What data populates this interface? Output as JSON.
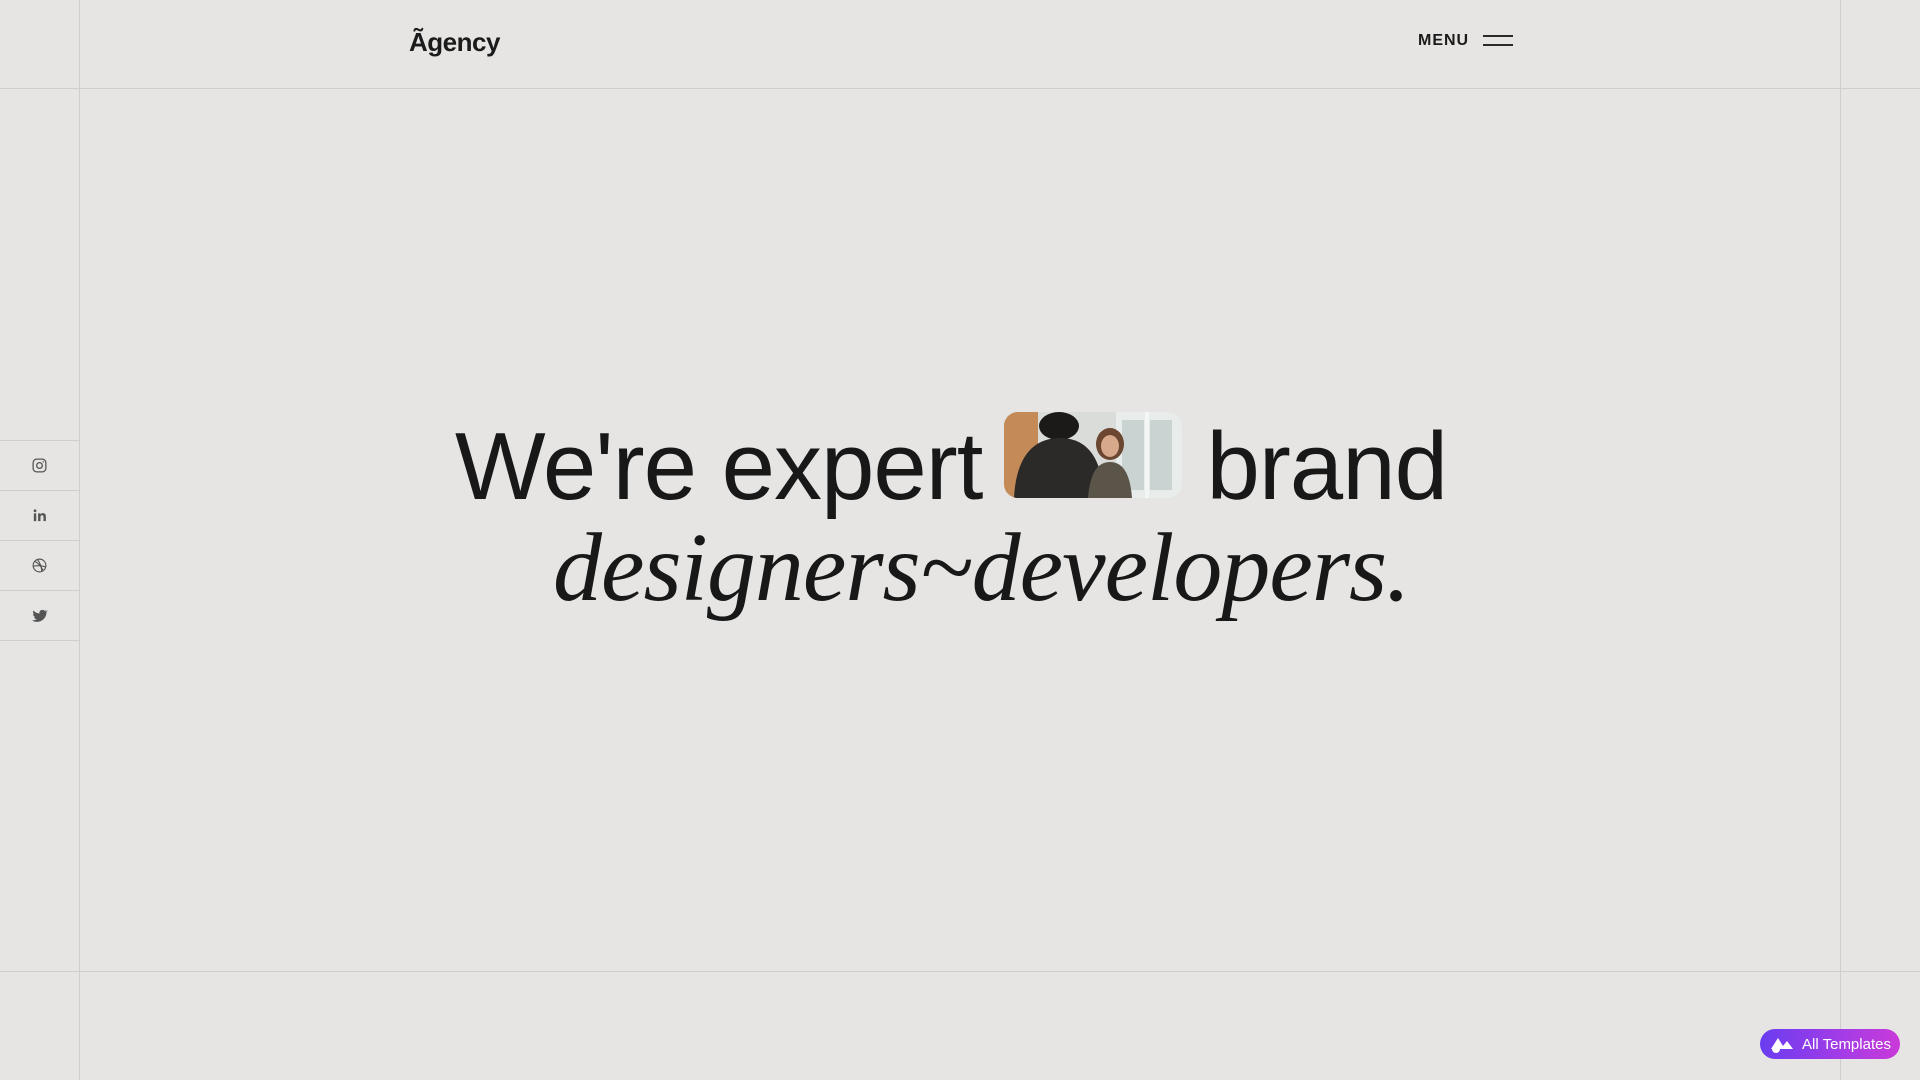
{
  "header": {
    "logo": "Ãgency",
    "menu_label": "MENU"
  },
  "social": {
    "items": [
      {
        "name": "instagram-icon"
      },
      {
        "name": "linkedin-icon"
      },
      {
        "name": "dribbble-icon"
      },
      {
        "name": "twitter-icon"
      }
    ]
  },
  "hero": {
    "line1_start": "We're expert",
    "line1_end": "brand",
    "line2": "designers~developers."
  },
  "badge": {
    "label": "All Templates"
  },
  "colors": {
    "background": "#e6e5e3",
    "text": "#181818",
    "grid_line": "#cfcecc",
    "badge_start": "#6a3df0",
    "badge_end": "#c93ad8"
  }
}
